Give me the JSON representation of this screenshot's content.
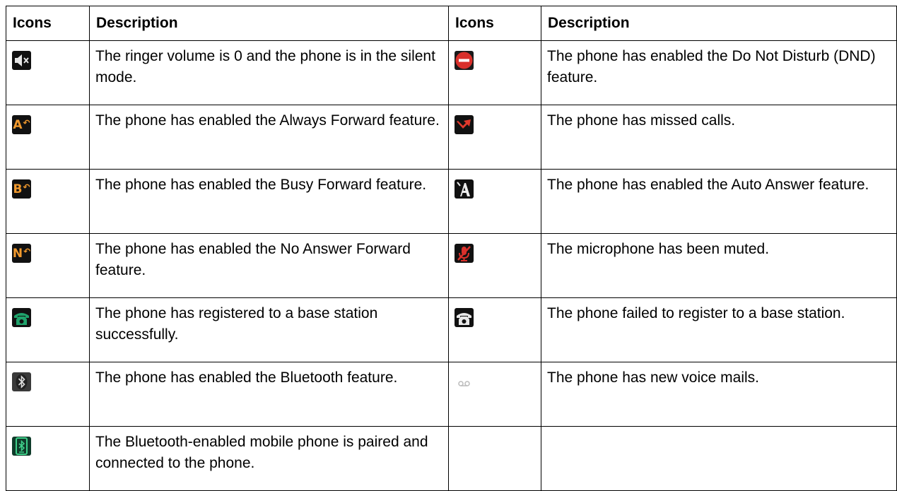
{
  "headers": {
    "icons": "Icons",
    "description": "Description",
    "icons2": "Icons",
    "description2": "Description"
  },
  "rows": [
    {
      "left_icon": "speaker-mute-icon",
      "left_desc": "The ringer volume is 0 and the phone is in the silent mode.",
      "right_icon": "do-not-disturb-icon",
      "right_desc": "The phone has enabled the Do Not Disturb (DND) feature."
    },
    {
      "left_icon": "always-forward-icon",
      "left_icon_letter": "A",
      "left_desc": "The phone has enabled the Always Forward feature.",
      "right_icon": "missed-call-icon",
      "right_desc": "The phone has missed calls."
    },
    {
      "left_icon": "busy-forward-icon",
      "left_icon_letter": "B",
      "left_desc": "The phone has enabled the Busy Forward feature.",
      "right_icon": "auto-answer-icon",
      "right_desc": "The phone has enabled the Auto Answer feature."
    },
    {
      "left_icon": "no-answer-forward-icon",
      "left_icon_letter": "N",
      "left_desc": "The phone has enabled the No Answer Forward feature.",
      "right_icon": "microphone-muted-icon",
      "right_desc": "The microphone has been muted."
    },
    {
      "left_icon": "phone-registered-icon",
      "left_desc": "The phone has registered to a base station successfully.",
      "right_icon": "phone-register-failed-icon",
      "right_desc": "The phone failed to register to a base station."
    },
    {
      "left_icon": "bluetooth-icon",
      "left_desc": "The phone has enabled the Bluetooth feature.",
      "right_icon": "voicemail-icon",
      "right_desc": "The phone has new voice mails."
    },
    {
      "left_icon": "bluetooth-mobile-paired-icon",
      "left_desc": "The Bluetooth-enabled mobile phone is paired and connected to the phone.",
      "right_icon": "",
      "right_desc": ""
    }
  ],
  "colors": {
    "forward_orange": "#f29a2e",
    "dnd_red": "#d9302b",
    "missed_red": "#e0392c",
    "registered_green": "#1fa36b",
    "icon_bg": "#111111"
  }
}
